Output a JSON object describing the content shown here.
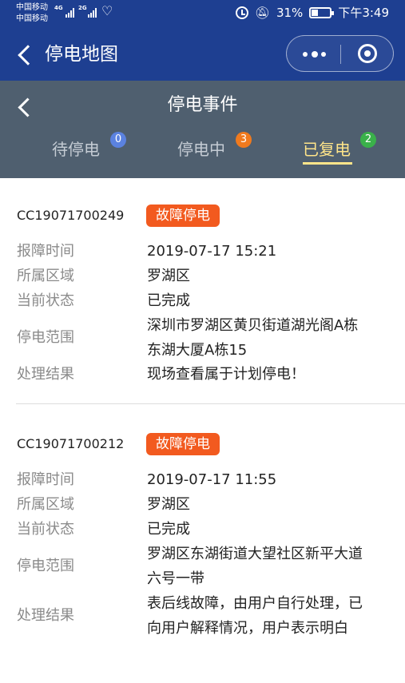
{
  "status_bar": {
    "carrier1": "中国移动",
    "carrier2": "中国移动",
    "net1": "4G",
    "net2": "2G",
    "battery_percent": "31%",
    "time": "下午3:49"
  },
  "navbar": {
    "title": "停电地图"
  },
  "page_header": {
    "title": "停电事件",
    "tabs": [
      {
        "label": "待停电",
        "count": "0",
        "badge_color": "#5b82e0"
      },
      {
        "label": "停电中",
        "count": "3",
        "badge_color": "#f07a1e"
      },
      {
        "label": "已复电",
        "count": "2",
        "badge_color": "#3ab14a"
      }
    ]
  },
  "colors": {
    "nav_bg": "#1e3f91",
    "header_bg": "#4f5f6f",
    "active_tab": "#ffe58a",
    "tag_bg": "#f25a1f"
  },
  "events": [
    {
      "code": "CC19071700249",
      "tag": "故障停电",
      "fields": [
        {
          "label": "报障时间",
          "value": "2019-07-17 15:21"
        },
        {
          "label": "所属区域",
          "value": "罗湖区"
        },
        {
          "label": "当前状态",
          "value": "已完成"
        },
        {
          "label": "停电范围",
          "value_lines": [
            "深圳市罗湖区黄贝街道湖光阁A栋",
            "东湖大厦A栋15"
          ]
        },
        {
          "label": "处理结果",
          "value": "现场查看属于计划停电！"
        }
      ]
    },
    {
      "code": "CC19071700212",
      "tag": "故障停电",
      "fields": [
        {
          "label": "报障时间",
          "value": "2019-07-17 11:55"
        },
        {
          "label": "所属区域",
          "value": "罗湖区"
        },
        {
          "label": "当前状态",
          "value": "已完成"
        },
        {
          "label": "停电范围",
          "value_lines": [
            "罗湖区东湖街道大望社区新平大道",
            "六号一带"
          ]
        },
        {
          "label": "处理结果",
          "value_lines": [
            "表后线故障，由用户自行处理，已",
            "向用户解释情况，用户表示明白"
          ]
        }
      ]
    }
  ]
}
